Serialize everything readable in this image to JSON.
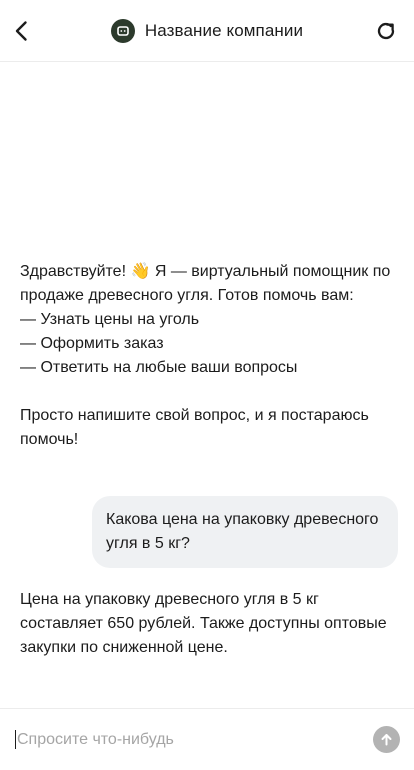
{
  "header": {
    "title": "Название компании",
    "back_icon": "chevron-left-icon",
    "refresh_icon": "refresh-icon",
    "avatar_icon": "bot-icon",
    "avatar_color": "#2c3a2c"
  },
  "messages": {
    "bot_greeting": {
      "line1_prefix": "Здравствуйте!",
      "emoji": "👋",
      "line1_suffix": "Я — виртуальный помощник по продаже древесного угля. Готов помочь вам:",
      "items": [
        "— Узнать цены на уголь",
        "— Оформить заказ",
        "— Ответить на любые ваши вопросы"
      ],
      "closing": "Просто напишите свой вопрос, и я постараюсь помочь!"
    },
    "user_question": "Какова цена на упаковку древесного угля в 5 кг?",
    "bot_answer": "Цена на упаковку древесного угля в 5 кг составляет 650 рублей. Также доступны оптовые закупки по сниженной цене."
  },
  "input": {
    "placeholder": "Спросите что-нибудь",
    "value": "",
    "send_icon": "arrow-up-icon"
  },
  "colors": {
    "user_bubble": "#eff1f3",
    "send_button": "#b3b3b3",
    "text": "#1c1c1c"
  }
}
